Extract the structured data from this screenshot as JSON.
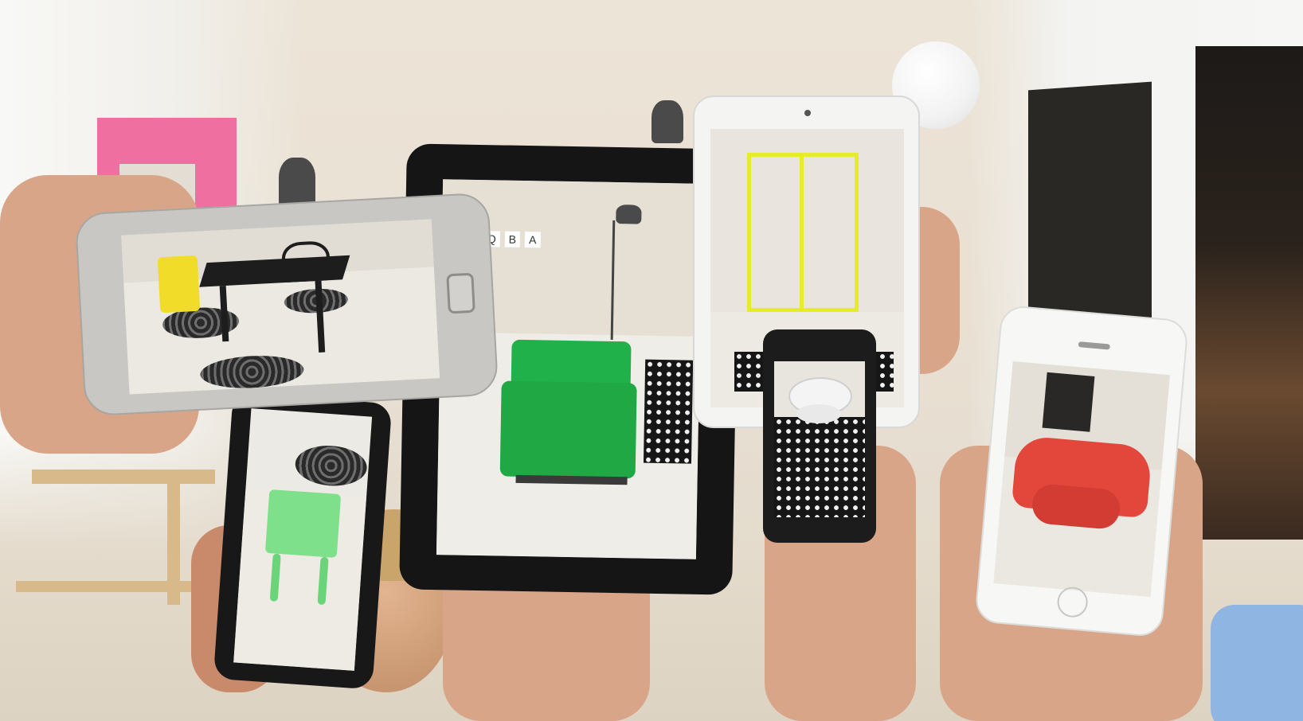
{
  "scene": {
    "description_visible_text": [],
    "accent_colors": {
      "sofa": "#21b14a",
      "chair_green": "#7ee08a",
      "chair_yellow": "#f2dc2a",
      "armchair_red": "#e3473c",
      "shelf_outline": "#e6ec2a",
      "pink_frame": "#ef6fa0"
    }
  },
  "devices": {
    "phone_left": {
      "icon": "smartphone-icon"
    },
    "tablet_center": {
      "icon": "tablet-icon",
      "wall_letters": [
        "Q",
        "B",
        "A"
      ]
    },
    "ipad_white": {
      "icon": "tablet-icon"
    },
    "phone_small": {
      "icon": "smartphone-icon"
    },
    "iphone_white": {
      "icon": "smartphone-icon"
    },
    "phone_bottom": {
      "icon": "smartphone-icon"
    }
  }
}
